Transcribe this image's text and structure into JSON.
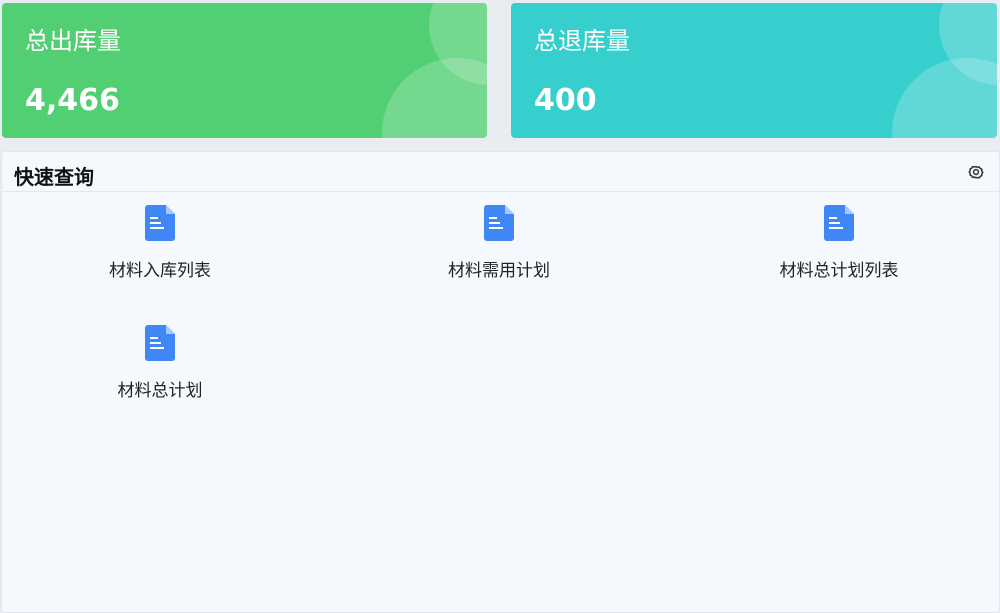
{
  "stats": {
    "outbound": {
      "label": "总出库量",
      "value": "4,466",
      "color": "#52cf72"
    },
    "return": {
      "label": "总退库量",
      "value": "400",
      "color": "#37cfcd"
    }
  },
  "quick_query": {
    "title": "快速查询",
    "settings_icon": "gear-icon",
    "items": [
      {
        "label": "材料入库列表",
        "icon": "document-icon"
      },
      {
        "label": "材料需用计划",
        "icon": "document-icon"
      },
      {
        "label": "材料总计划列表",
        "icon": "document-icon"
      },
      {
        "label": "材料总计划",
        "icon": "document-icon"
      }
    ],
    "icon_color": "#3f87f5"
  }
}
